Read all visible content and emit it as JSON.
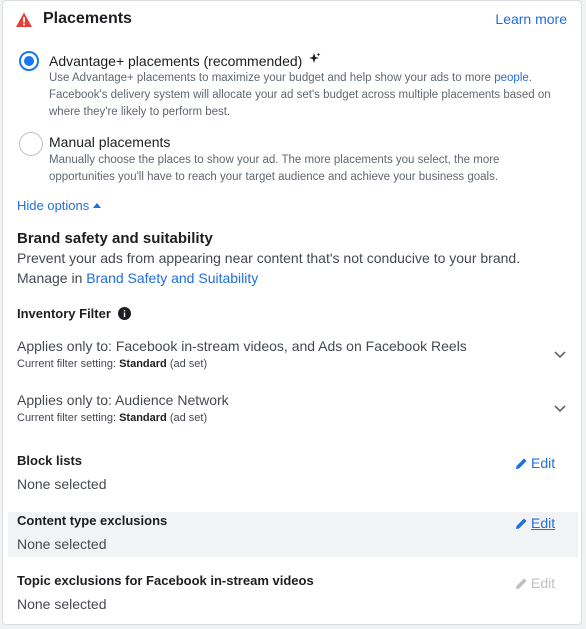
{
  "header": {
    "title": "Placements",
    "learn_more": "Learn more"
  },
  "options": {
    "advantage": {
      "label": "Advantage+ placements (recommended)",
      "desc_1": "Use Advantage+ placements to maximize your budget and help show your ads to more ",
      "desc_link": "people",
      "desc_2": ". Facebook's delivery system will allocate your ad set's budget across multiple placements based on where they're likely to perform best."
    },
    "manual": {
      "label": "Manual placements",
      "desc": "Manually choose the places to show your ad. The more placements you select, the more opportunities you'll have to reach your target audience and achieve your business goals."
    },
    "hide_options": "Hide options"
  },
  "brand_safety": {
    "title": "Brand safety and suitability",
    "line1": "Prevent your ads from appearing near content that's not conducive to your brand.",
    "manage_prefix": "Manage in ",
    "manage_link": "Brand Safety and Suitability"
  },
  "inventory_filter": {
    "title": "Inventory Filter",
    "items": [
      {
        "applies": "Applies only to: Facebook in-stream videos, and Ads on Facebook Reels",
        "setting_prefix": "Current filter setting: ",
        "setting_value": "Standard",
        "setting_suffix": " (ad set)"
      },
      {
        "applies": "Applies only to: Audience Network",
        "setting_prefix": "Current filter setting: ",
        "setting_value": "Standard",
        "setting_suffix": " (ad set)"
      }
    ]
  },
  "sections": [
    {
      "title": "Block lists",
      "value": "None selected",
      "edit": "Edit"
    },
    {
      "title": "Content type exclusions",
      "value": "None selected",
      "edit": "Edit"
    },
    {
      "title": "Topic exclusions for Facebook in-stream videos",
      "value": "None selected",
      "edit": "Edit"
    }
  ],
  "colors": {
    "accent": "#1877f2",
    "link": "#216fdb",
    "warning": "#e0413a"
  }
}
